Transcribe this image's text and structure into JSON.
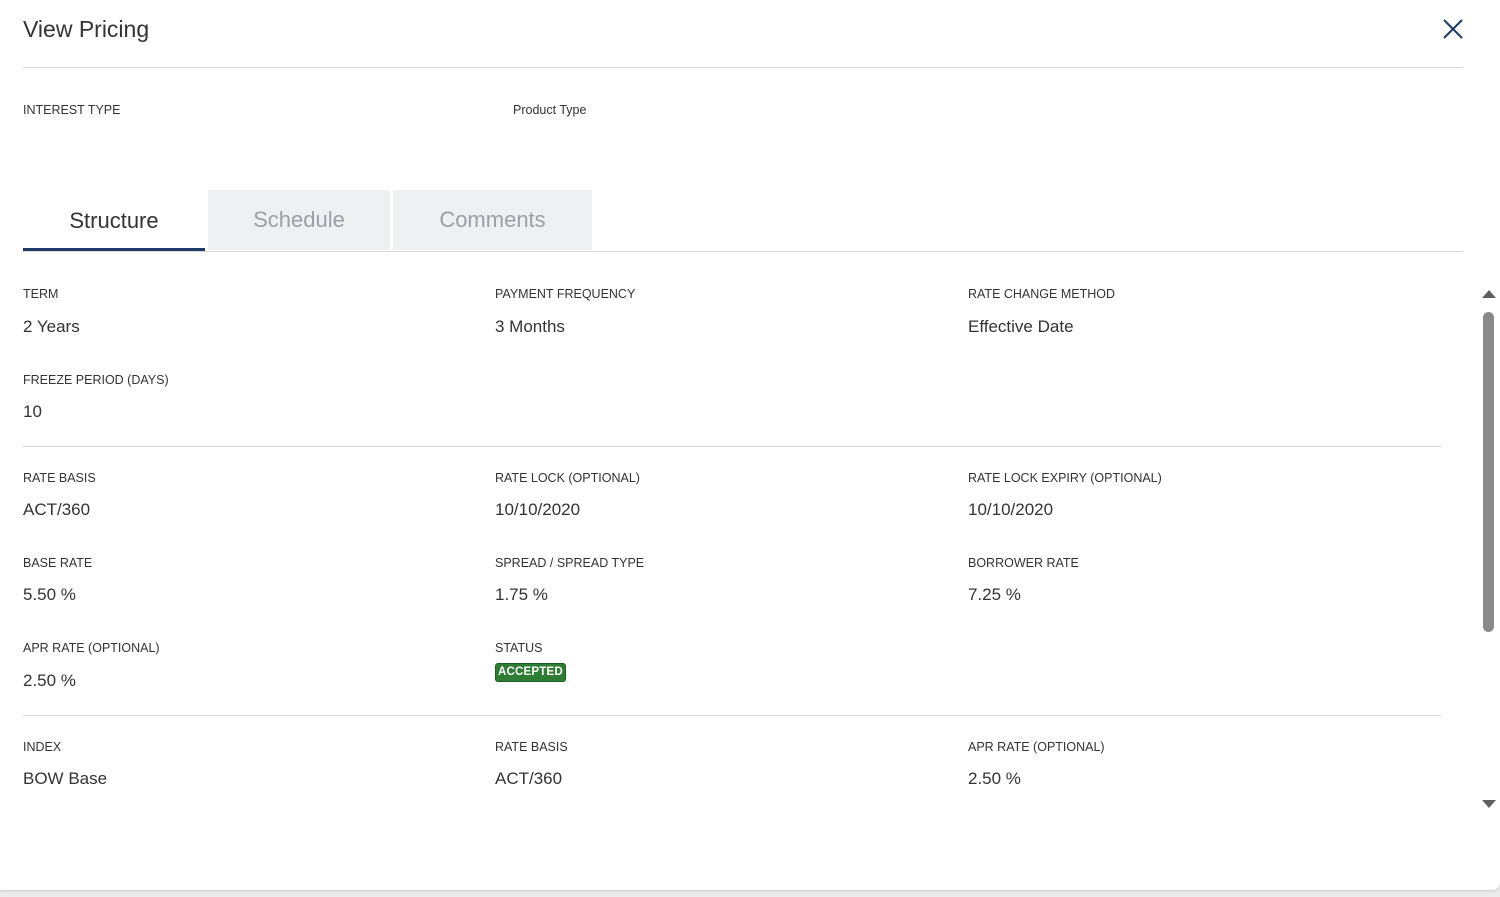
{
  "modal": {
    "title": "View Pricing"
  },
  "meta": {
    "interest_type_label": "INTEREST TYPE",
    "product_type_label": "Product Type"
  },
  "tabs": [
    {
      "label": "Structure",
      "active": true
    },
    {
      "label": "Schedule",
      "active": false
    },
    {
      "label": "Comments",
      "active": false
    }
  ],
  "sections": {
    "term": {
      "term_label": "TERM",
      "term_value": "2 Years",
      "payment_frequency_label": "PAYMENT FREQUENCY",
      "payment_frequency_value": "3 Months",
      "rate_change_method_label": "RATE CHANGE METHOD",
      "rate_change_method_value": "Effective Date",
      "freeze_period_label": "FREEZE PERIOD (DAYS)",
      "freeze_period_value": "10"
    },
    "rate": {
      "rate_basis_label": "RATE BASIS",
      "rate_basis_value": "ACT/360",
      "rate_lock_label": "RATE LOCK (OPTIONAL)",
      "rate_lock_value": "10/10/2020",
      "rate_lock_expiry_label": "RATE LOCK EXPIRY (OPTIONAL)",
      "rate_lock_expiry_value": "10/10/2020",
      "base_rate_label": "BASE RATE",
      "base_rate_value": "5.50 %",
      "spread_label": "SPREAD / SPREAD TYPE",
      "spread_value": "1.75 %",
      "borrower_rate_label": "BORROWER RATE",
      "borrower_rate_value": "7.25 %",
      "apr_rate_label": "APR RATE (OPTIONAL)",
      "apr_rate_value": "2.50 %",
      "status_label": "STATUS",
      "status_value": "ACCEPTED"
    },
    "index": {
      "index_label": "INDEX",
      "index_value": "BOW Base",
      "rate_basis_label": "RATE BASIS",
      "rate_basis_value": "ACT/360",
      "apr_rate_label": "APR RATE (OPTIONAL)",
      "apr_rate_value": "2.50 %"
    }
  },
  "colors": {
    "accent": "#1f3a64",
    "status_accepted": "#2e7d32",
    "divider": "#d6d6d6"
  },
  "icons": {
    "close": "close-icon",
    "scroll_up": "arrow-up-icon",
    "scroll_down": "arrow-down-icon"
  }
}
